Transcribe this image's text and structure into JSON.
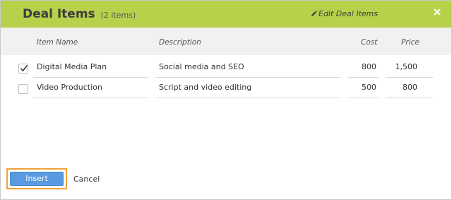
{
  "dialog": {
    "title": "Deal Items",
    "count_label": "(2 items)",
    "edit_label": "Edit Deal Items",
    "edit_icon": "pencil-icon",
    "close_icon": "close-icon"
  },
  "table": {
    "columns": [
      "Item Name",
      "Description",
      "Cost",
      "Price"
    ],
    "rows": [
      {
        "checked": true,
        "name": "Digital Media Plan",
        "description": "Social media and SEO",
        "cost": "800",
        "price": "1,500"
      },
      {
        "checked": false,
        "name": "Video Production",
        "description": "Script and video editing",
        "cost": "500",
        "price": "800"
      }
    ]
  },
  "footer": {
    "insert_label": "Insert",
    "cancel_label": "Cancel"
  },
  "colors": {
    "header_bg": "#b8d14a",
    "insert_bg": "#5a9ae0",
    "insert_focus": "#f0a23b"
  }
}
